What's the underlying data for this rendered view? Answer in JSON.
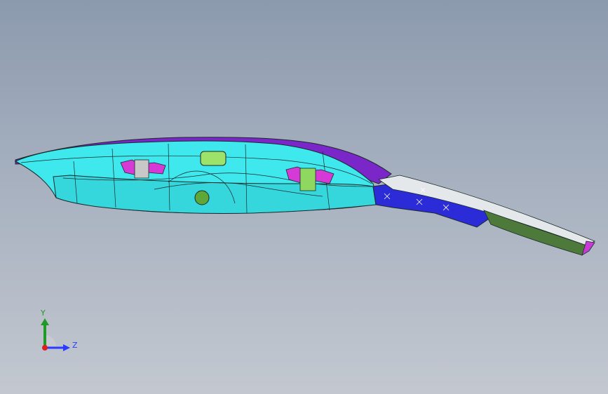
{
  "viewport": {
    "background_top": "#8c9aae",
    "background_bottom": "#c3c8d0"
  },
  "model": {
    "colors": {
      "cyan_body": "#3ee8ec",
      "purple_top": "#7a26c8",
      "blue_end": "#2b2bd8",
      "green_rail": "#4d7a3a",
      "magenta_bracket": "#d63ad6",
      "edge": "#1a2a2a",
      "window": "#9de36a"
    }
  },
  "triad": {
    "y_label": "Y",
    "z_label": "Z",
    "y_color": "#1f9a2a",
    "z_color": "#2a3cff",
    "x_color": "#e02020"
  }
}
